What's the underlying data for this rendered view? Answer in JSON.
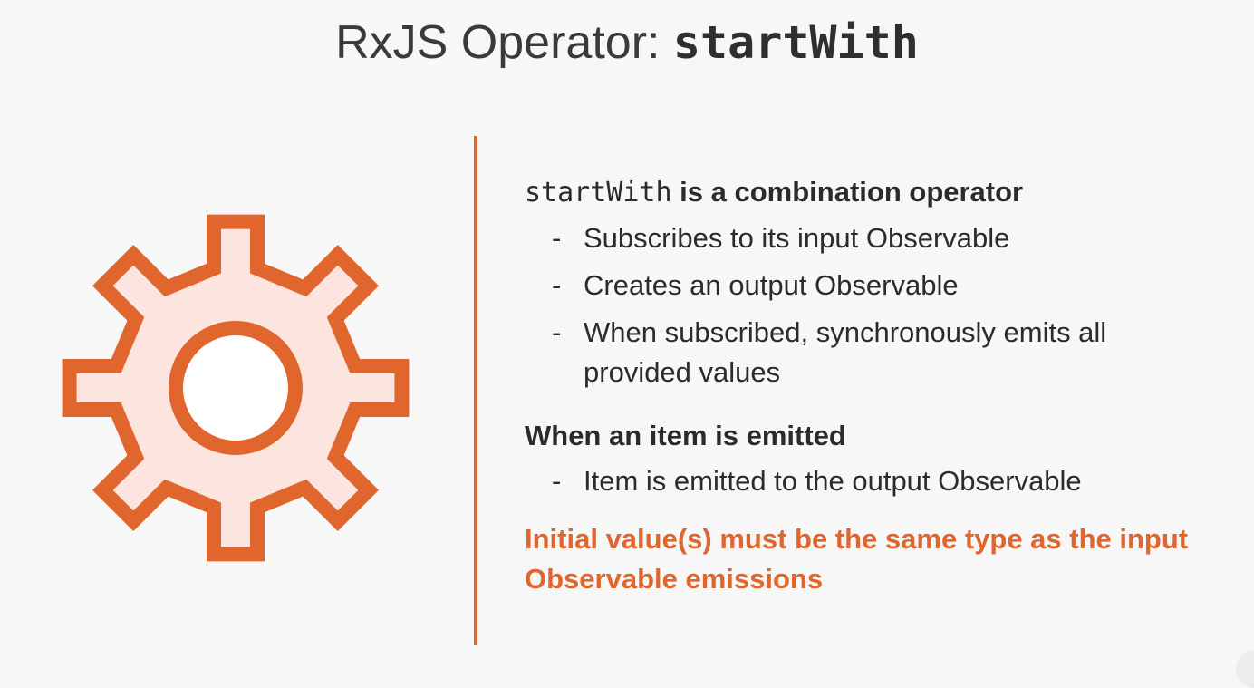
{
  "title": {
    "prefix": "RxJS Operator: ",
    "operator": "startWith"
  },
  "icon": "gear-icon",
  "colors": {
    "accent": "#e0662d",
    "gear_fill": "#fbe5de",
    "text": "#2b2b2b",
    "background": "#f7f7f7"
  },
  "description": {
    "code": "startWith",
    "text": " is a combination operator",
    "bullets": [
      "Subscribes to its input Observable",
      "Creates an output Observable",
      "When subscribed, synchronously emits all provided values"
    ]
  },
  "emission": {
    "heading": "When an item is emitted",
    "bullets": [
      "Item is emitted to the output Observable"
    ]
  },
  "warning": "Initial value(s) must be the same type as the input Observable emissions",
  "bullet_marker": "-"
}
